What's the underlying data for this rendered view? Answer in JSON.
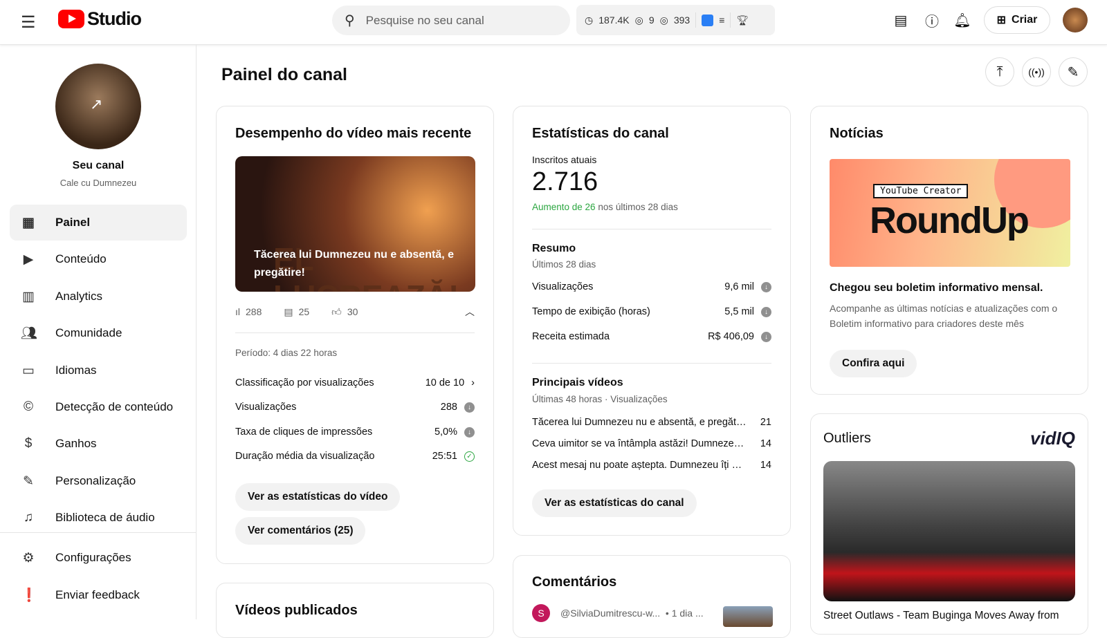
{
  "header": {
    "logo": "Studio",
    "search_placeholder": "Pesquise no seu canal",
    "stats": {
      "watch": "187.4K",
      "views1": "9",
      "views2": "393"
    },
    "create_label": "Criar"
  },
  "sidebar": {
    "channel_title": "Seu canal",
    "channel_name": "Cale cu Dumnezeu",
    "items": [
      {
        "label": "Painel"
      },
      {
        "label": "Conteúdo"
      },
      {
        "label": "Analytics"
      },
      {
        "label": "Comunidade"
      },
      {
        "label": "Idiomas"
      },
      {
        "label": "Detecção de conteúdo"
      },
      {
        "label": "Ganhos"
      },
      {
        "label": "Personalização"
      },
      {
        "label": "Biblioteca de áudio"
      },
      {
        "label": "Configurações"
      },
      {
        "label": "Enviar feedback"
      }
    ]
  },
  "page_title": "Painel do canal",
  "latest": {
    "title": "Desempenho do vídeo mais recente",
    "video_title": "Tăcerea lui Dumnezeu nu e absentă, e pregătire!",
    "thumb_text": "EL LUCREAZĂ!",
    "views": "288",
    "comments": "25",
    "likes": "30",
    "period": "Período: 4 dias 22 horas",
    "rows": [
      {
        "label": "Classificação por visualizações",
        "value": "10 de 10"
      },
      {
        "label": "Visualizações",
        "value": "288"
      },
      {
        "label": "Taxa de cliques de impressões",
        "value": "5,0%"
      },
      {
        "label": "Duração média da visualização",
        "value": "25:51"
      }
    ],
    "btn_stats": "Ver as estatísticas do vídeo",
    "btn_comments": "Ver comentários (25)"
  },
  "stats": {
    "title": "Estatísticas do canal",
    "subs_label": "Inscritos atuais",
    "subs": "2.716",
    "growth_prefix": "Aumento de 26",
    "growth_suffix": " nos últimos 28 dias",
    "summary_title": "Resumo",
    "summary_sub": "Últimos 28 dias",
    "summary": [
      {
        "label": "Visualizações",
        "value": "9,6 mil"
      },
      {
        "label": "Tempo de exibição (horas)",
        "value": "5,5 mil"
      },
      {
        "label": "Receita estimada",
        "value": "R$ 406,09"
      }
    ],
    "top_title": "Principais vídeos",
    "top_sub": "Últimas 48 horas · Visualizações",
    "top": [
      {
        "title": "Tăcerea lui Dumnezeu nu e absentă, e pregătire!",
        "views": "21"
      },
      {
        "title": "Ceva uimitor se va întâmpla astăzi! Dumnezeu e...",
        "views": "14"
      },
      {
        "title": "Acest mesaj nu poate aștepta. Dumnezeu îți vor...",
        "views": "14"
      }
    ],
    "btn": "Ver as estatísticas do canal"
  },
  "news": {
    "title": "Notícias",
    "banner_tag": "YouTube Creator",
    "banner_main": "RoundUp",
    "headline": "Chegou seu boletim informativo mensal.",
    "body": "Acompanhe as últimas notícias e atualizações com o Boletim informativo para criadores deste mês",
    "btn": "Confira aqui"
  },
  "outliers": {
    "title": "Outliers",
    "brand": "vidIQ",
    "video_title": "Street Outlaws - Team Buginga Moves Away from"
  },
  "comments": {
    "title": "Comentários",
    "author": "@SilviaDumitrescu-w...",
    "time": "• 1 dia ...",
    "avatar_letter": "S"
  },
  "published": {
    "title": "Vídeos publicados"
  }
}
